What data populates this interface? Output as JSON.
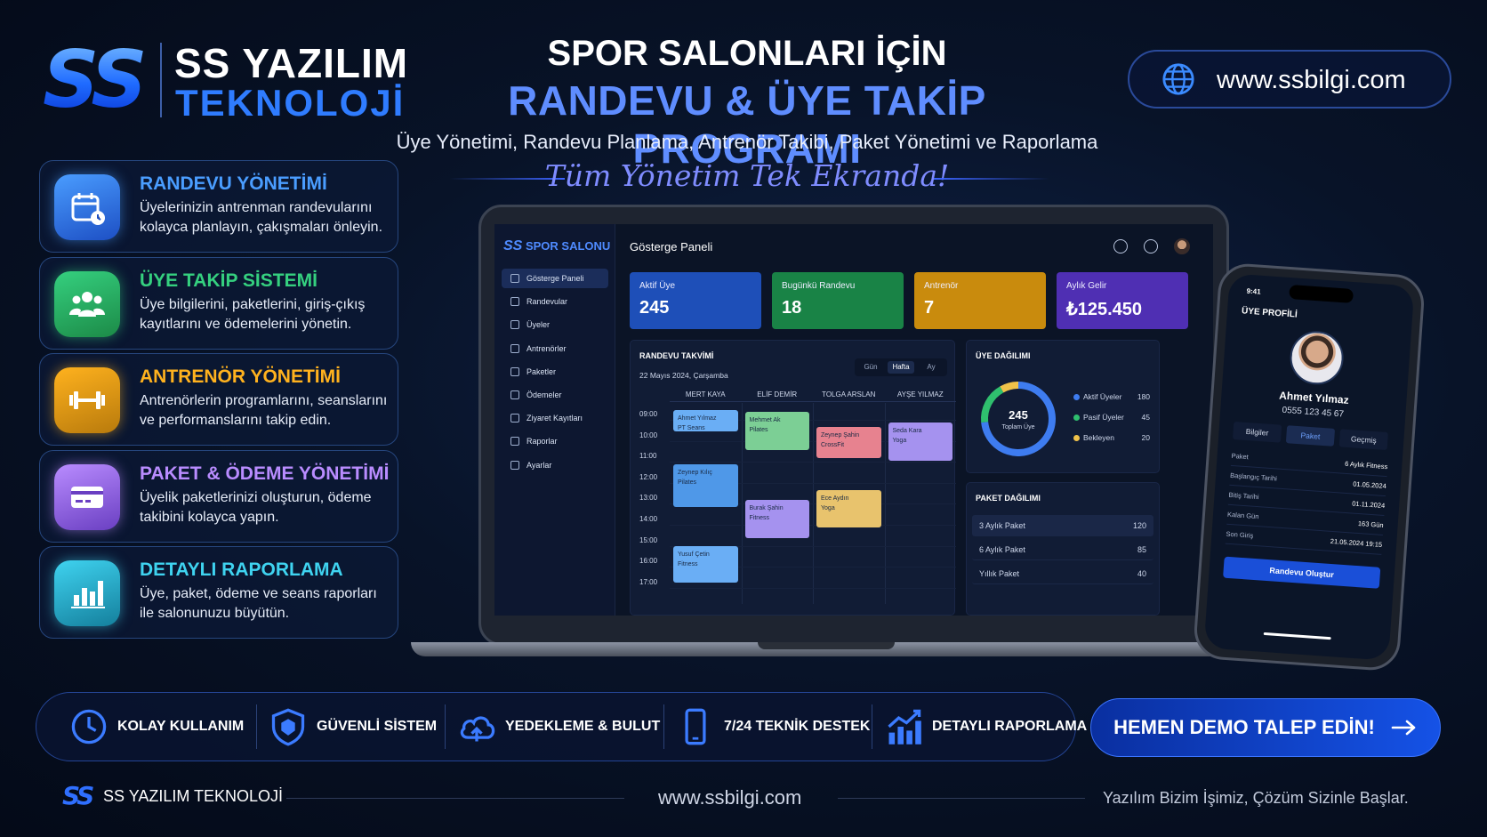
{
  "brand": {
    "logo_mark": "SS",
    "name_line1": "SS YAZILIM",
    "name_line2": "TEKNOLOJİ"
  },
  "header": {
    "title_line1": "SPOR SALONLARI İÇİN",
    "title_line2": "RANDEVU & ÜYE TAKİP PROGRAMI",
    "subtitle": "Üye Yönetimi, Randevu Planlama, Antrenör Takibi, Paket Yönetimi ve Raporlama",
    "tagline": "Tüm Yönetim Tek Ekranda!",
    "website": "www.ssbilgi.com",
    "website_icon": "globe-icon"
  },
  "features": [
    {
      "title": "RANDEVU YÖNETİMİ",
      "desc": "Üyelerinizin antrenman randevularını kolayca planlayın, çakışmaları önleyin.",
      "icon": "calendar-clock-icon",
      "color": "#4a9dff",
      "bg": "#1d4fc4"
    },
    {
      "title": "ÜYE TAKİP SİSTEMİ",
      "desc": "Üye bilgilerini, paketlerini, giriş-çıkış kayıtlarını ve ödemelerini yönetin.",
      "icon": "users-icon",
      "color": "#35d07f",
      "bg": "#1c8a47"
    },
    {
      "title": "ANTRENÖR YÖNETİMİ",
      "desc": "Antrenörlerin programlarını, seanslarını ve performanslarını takip edin.",
      "icon": "dumbbell-icon",
      "color": "#ffb21e",
      "bg": "#b87a0c"
    },
    {
      "title": "PAKET & ÖDEME YÖNETİMİ",
      "desc": "Üyelik paketlerinizi oluşturun, ödeme takibini kolayca yapın.",
      "icon": "credit-card-icon",
      "color": "#b98cff",
      "bg": "#6a3fc2"
    },
    {
      "title": "DETAYLI RAPORLAMA",
      "desc": "Üye, paket, ödeme ve seans raporları ile salonunuzu büyütün.",
      "icon": "bar-chart-icon",
      "color": "#3fd3f0",
      "bg": "#147f9c"
    }
  ],
  "app": {
    "logo": "SPOR SALONU",
    "page_title": "Gösterge Paneli",
    "menu": [
      "Gösterge Paneli",
      "Randevular",
      "Üyeler",
      "Antrenörler",
      "Paketler",
      "Ödemeler",
      "Ziyaret Kayıtları",
      "Raporlar",
      "Ayarlar"
    ],
    "kpis": [
      {
        "label": "Aktif Üye",
        "value": "245",
        "color": "#1e4fb8"
      },
      {
        "label": "Bugünkü Randevu",
        "value": "18",
        "color": "#198346"
      },
      {
        "label": "Antrenör",
        "value": "7",
        "color": "#c98b0d"
      },
      {
        "label": "Aylık Gelir",
        "value": "₺125.450",
        "color": "#4f2fb3"
      }
    ],
    "calendar": {
      "title": "RANDEVU TAKVİMİ",
      "date": "22 Mayıs 2024, Çarşamba",
      "views": [
        "Gün",
        "Hafta",
        "Ay"
      ],
      "active_view": "Hafta",
      "trainers": [
        "MERT KAYA",
        "ELİF DEMİR",
        "TOLGA ARSLAN",
        "AYŞE YILMAZ"
      ],
      "hours": [
        "09:00",
        "10:00",
        "11:00",
        "12:00",
        "13:00",
        "14:00",
        "15:00",
        "16:00",
        "17:00"
      ],
      "events": [
        {
          "col": 0,
          "start": 9.0,
          "end": 10.0,
          "name": "Ahmet Yılmaz",
          "type": "PT Seans",
          "color": "#6aaef5"
        },
        {
          "col": 1,
          "start": 9.1,
          "end": 10.9,
          "name": "Mehmet Ak",
          "type": "Pilates",
          "color": "#7ccf95"
        },
        {
          "col": 2,
          "start": 9.8,
          "end": 11.3,
          "name": "Zeynep Şahin",
          "type": "CrossFit",
          "color": "#e7828f"
        },
        {
          "col": 3,
          "start": 9.6,
          "end": 11.4,
          "name": "Seda Kara",
          "type": "Yoga",
          "color": "#a592ef"
        },
        {
          "col": 0,
          "start": 11.6,
          "end": 13.6,
          "name": "Zeynep Kılıç",
          "type": "Pilates",
          "color": "#4f98e8"
        },
        {
          "col": 2,
          "start": 12.8,
          "end": 14.6,
          "name": "Ece Aydın",
          "type": "Yoga",
          "color": "#e8c36d"
        },
        {
          "col": 1,
          "start": 13.3,
          "end": 15.1,
          "name": "Burak Şahin",
          "type": "Fitness",
          "color": "#a592ef"
        },
        {
          "col": 0,
          "start": 15.5,
          "end": 17.2,
          "name": "Yusuf Çetin",
          "type": "Fitness",
          "color": "#6aaef5"
        }
      ]
    },
    "distribution": {
      "title": "ÜYE DAĞILIMI",
      "total": "245",
      "total_label": "Toplam Üye",
      "items": [
        {
          "label": "Aktif Üyeler",
          "value": 180,
          "color": "#3e7cf0"
        },
        {
          "label": "Pasif Üyeler",
          "value": 45,
          "color": "#2fbf6e"
        },
        {
          "label": "Bekleyen",
          "value": 20,
          "color": "#f0c24a"
        }
      ]
    },
    "packages": {
      "title": "PAKET DAĞILIMI",
      "items": [
        {
          "label": "3 Aylık Paket",
          "value": "120"
        },
        {
          "label": "6 Aylık Paket",
          "value": "85"
        },
        {
          "label": "Yıllık Paket",
          "value": "40"
        }
      ]
    }
  },
  "phone": {
    "status_left": "9:41",
    "title": "ÜYE PROFİLİ",
    "name": "Ahmet Yılmaz",
    "phone": "0555 123 45 67",
    "tabs": [
      "Bilgiler",
      "Paket",
      "Geçmiş"
    ],
    "active_tab": "Paket",
    "rows": [
      {
        "k": "Paket",
        "v": "6 Aylık Fitness"
      },
      {
        "k": "Başlangıç Tarihi",
        "v": "01.05.2024"
      },
      {
        "k": "Bitiş Tarihi",
        "v": "01.11.2024"
      },
      {
        "k": "Kalan Gün",
        "v": "163 Gün"
      },
      {
        "k": "Son Giriş",
        "v": "21.05.2024 19:15"
      }
    ],
    "button": "Randevu Oluştur"
  },
  "benefits": [
    {
      "label": "KOLAY KULLANIM",
      "icon": "clock-icon"
    },
    {
      "label": "GÜVENLİ SİSTEM",
      "icon": "shield-icon"
    },
    {
      "label": "YEDEKLEME & BULUT",
      "icon": "cloud-upload-icon"
    },
    {
      "label": "7/24 TEKNİK DESTEK",
      "icon": "mobile-icon"
    },
    {
      "label": "DETAYLI RAPORLAMA",
      "icon": "growth-chart-icon"
    }
  ],
  "cta": {
    "label": "HEMEN DEMO TALEP EDİN!",
    "icon": "arrow-right-icon"
  },
  "footer": {
    "brand": "SS YAZILIM TEKNOLOJİ",
    "website": "www.ssbilgi.com",
    "slogan": "Yazılım Bizim İşimiz, Çözüm Sizinle Başlar."
  }
}
